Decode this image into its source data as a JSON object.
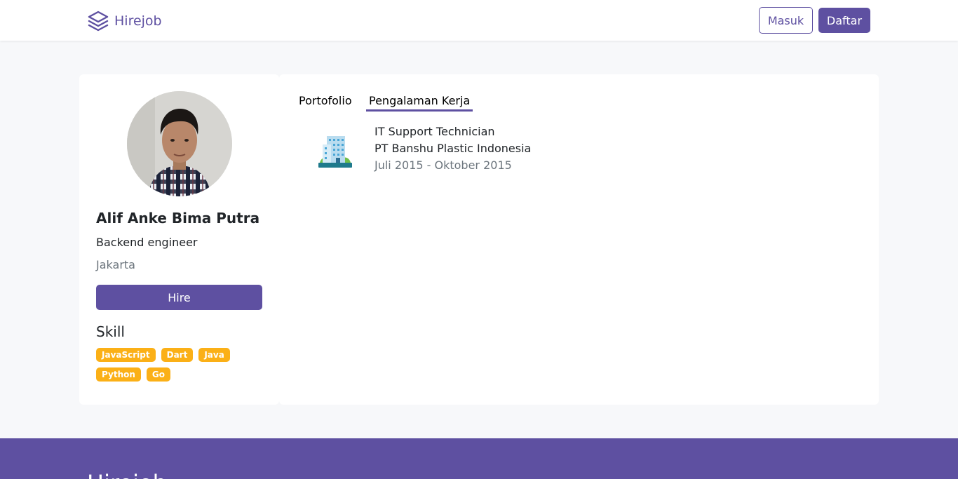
{
  "navbar": {
    "brand": "Hirejob",
    "login_label": "Masuk",
    "register_label": "Daftar"
  },
  "profile": {
    "name": "Alif Anke Bima Putra",
    "job_title": "Backend engineer",
    "location": "Jakarta",
    "hire_label": "Hire",
    "skill_title": "Skill",
    "skills": [
      "JavaScript",
      "Dart",
      "Java",
      "Python",
      "Go"
    ]
  },
  "tabs": {
    "portfolio": "Portofolio",
    "experience": "Pengalaman Kerja",
    "active": "experience"
  },
  "experience": [
    {
      "position": "IT Support Technician",
      "company": "PT Banshu Plastic Indonesia",
      "period": "Juli 2015 - Oktober 2015",
      "icon": "office-building-icon"
    }
  ],
  "footer": {
    "brand": "Hirejob"
  },
  "colors": {
    "primary": "#5e50a1",
    "badge": "#fbb017",
    "muted": "#6c757d",
    "background": "#f7f8fa"
  }
}
